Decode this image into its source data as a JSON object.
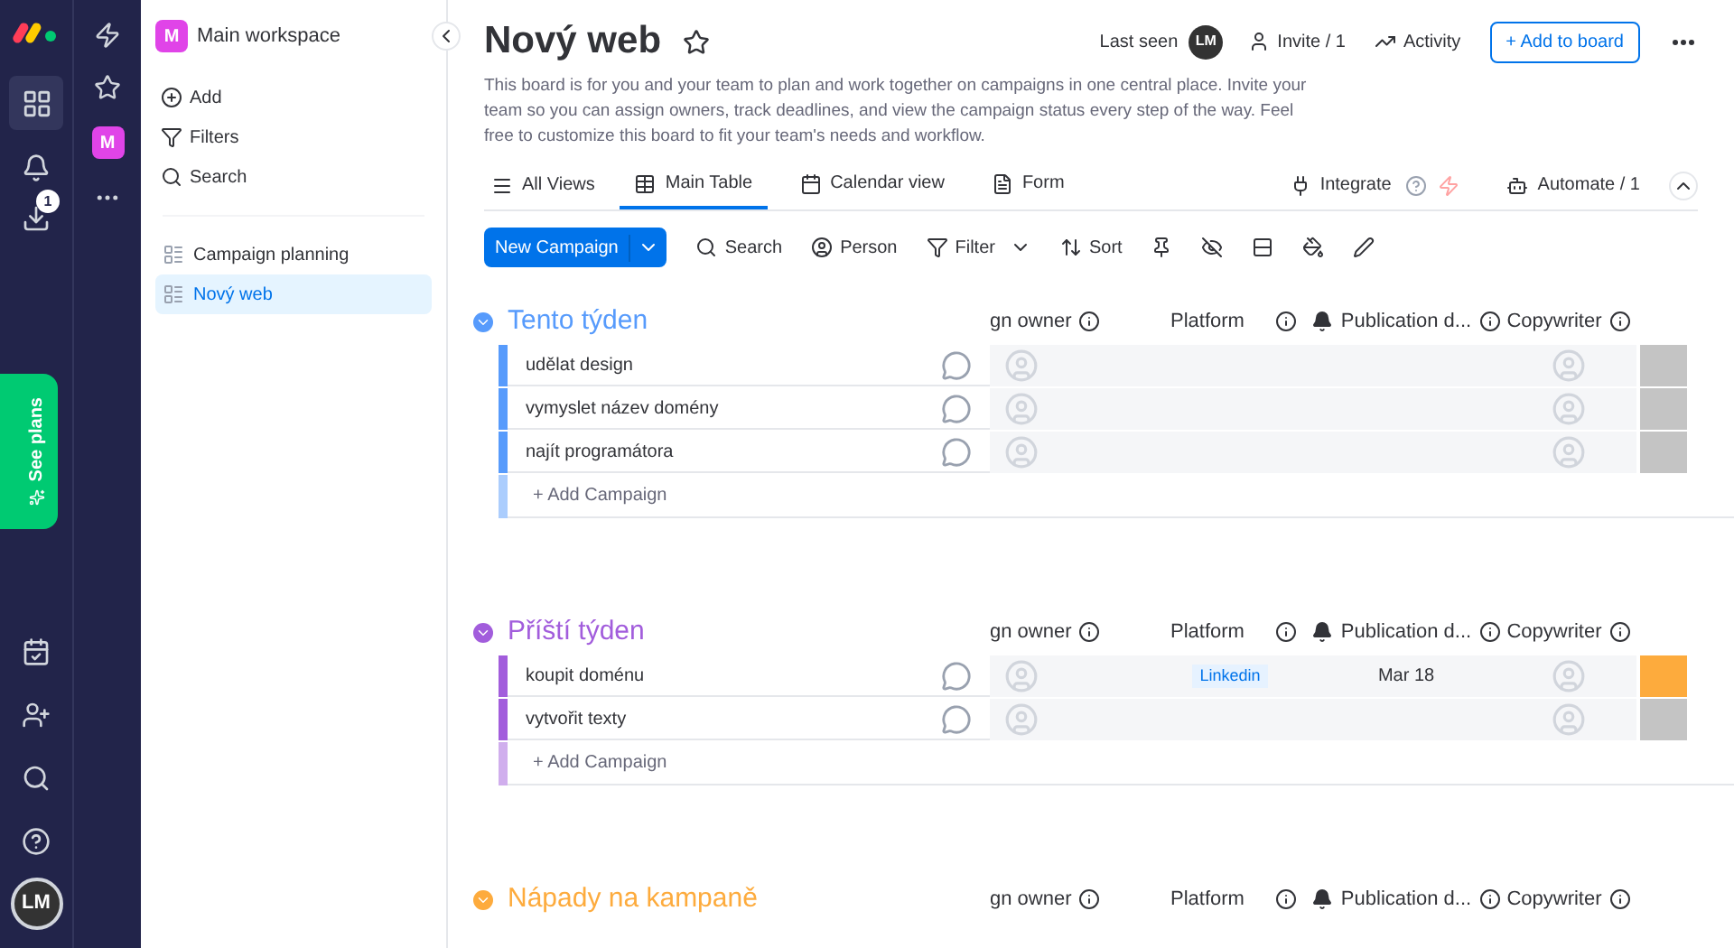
{
  "nav": {
    "notification_count": "1",
    "see_plans": "See plans",
    "avatar": "LM"
  },
  "workspace": {
    "name": "Main workspace",
    "badge": "M",
    "nav_badge": "M",
    "actions": [
      "Add",
      "Filters",
      "Search"
    ],
    "boards": [
      {
        "label": "Campaign planning",
        "selected": false
      },
      {
        "label": "Nový web",
        "selected": true
      }
    ]
  },
  "board": {
    "title": "Nový web",
    "last_seen": "Last seen",
    "avatar": "LM",
    "invite": "Invite / 1",
    "activity": "Activity",
    "add_to_board": "+ Add to board",
    "description": "This board is for you and your team to plan and work together on campaigns in one central place. Invite your team so you can assign owners, track deadlines, and view the campaign status every step of the way. Feel free to customize this board to fit your team's needs and workflow."
  },
  "views": {
    "all_views": "All Views",
    "tabs": [
      {
        "label": "Main Table",
        "selected": true
      },
      {
        "label": "Calendar view",
        "selected": false
      },
      {
        "label": "Form",
        "selected": false
      }
    ],
    "integrate": "Integrate",
    "automate": "Automate / 1"
  },
  "toolbar": {
    "new_item": "New Campaign",
    "items": [
      "Search",
      "Person",
      "Filter",
      "Sort"
    ]
  },
  "groups": [
    {
      "title": "Tento týden",
      "color": "#579bfc",
      "columns": [
        "gn owner",
        "Platform",
        "Publication d...",
        "Copywriter"
      ],
      "add": "+ Add Campaign",
      "rows": [
        {
          "name": "udělat design",
          "platform": "",
          "date": "",
          "color": "#c4c4c4"
        },
        {
          "name": "vymyslet název domény",
          "platform": "",
          "date": "",
          "color": "#c4c4c4"
        },
        {
          "name": "najít programátora",
          "platform": "",
          "date": "",
          "color": "#c4c4c4"
        }
      ]
    },
    {
      "title": "Příští týden",
      "color": "#a25ddc",
      "columns": [
        "gn owner",
        "Platform",
        "Publication d...",
        "Copywriter"
      ],
      "add": "+ Add Campaign",
      "rows": [
        {
          "name": "koupit doménu",
          "platform": "Linkedin",
          "date": "Mar 18",
          "color": "#fdab3d"
        },
        {
          "name": "vytvořit texty",
          "platform": "",
          "date": "",
          "color": "#c4c4c4"
        }
      ]
    },
    {
      "title": "Nápady na kampaně",
      "color": "#fdab3d",
      "columns": [
        "gn owner",
        "Platform",
        "Publication d...",
        "Copywriter"
      ]
    }
  ]
}
